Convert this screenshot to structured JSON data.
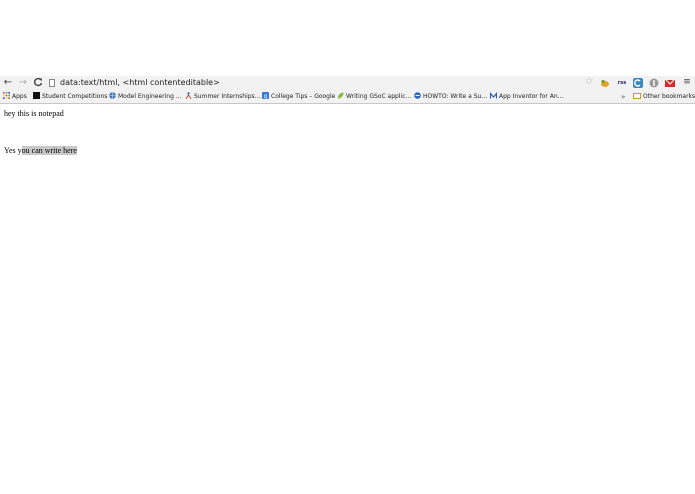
{
  "toolbar": {
    "url": "data:text/html, <html contenteditable>",
    "back_icon": "←",
    "forward_icon": "→",
    "reload_icon": "C",
    "star_icon": "☆",
    "menu_icon": "≡",
    "ext_text": "rss"
  },
  "bookmarks": {
    "items": [
      {
        "label": "Apps",
        "icon": "apps-grid-icon"
      },
      {
        "label": "Student Competitions",
        "icon": "black-square-icon"
      },
      {
        "label": "Model Engineering ...",
        "icon": "globe-icon"
      },
      {
        "label": "Summer Internships...",
        "icon": "figure-icon"
      },
      {
        "label": "College Tips – Google",
        "icon": "google-icon"
      },
      {
        "label": "Writing GSoC applic...",
        "icon": "leaf-icon"
      },
      {
        "label": "HOWTO: Write a Su...",
        "icon": "edge-icon"
      },
      {
        "label": "App Inventor for An...",
        "icon": "m-icon"
      }
    ],
    "more": "»",
    "other": "Other bookmarks"
  },
  "content": {
    "line1": "hey this is notepad",
    "line2_prefix": "Yes y",
    "line2_selected": "ou can write here"
  },
  "colors": {
    "chrome_bg": "#f2f2f2",
    "selection": "#c8c8c8"
  }
}
